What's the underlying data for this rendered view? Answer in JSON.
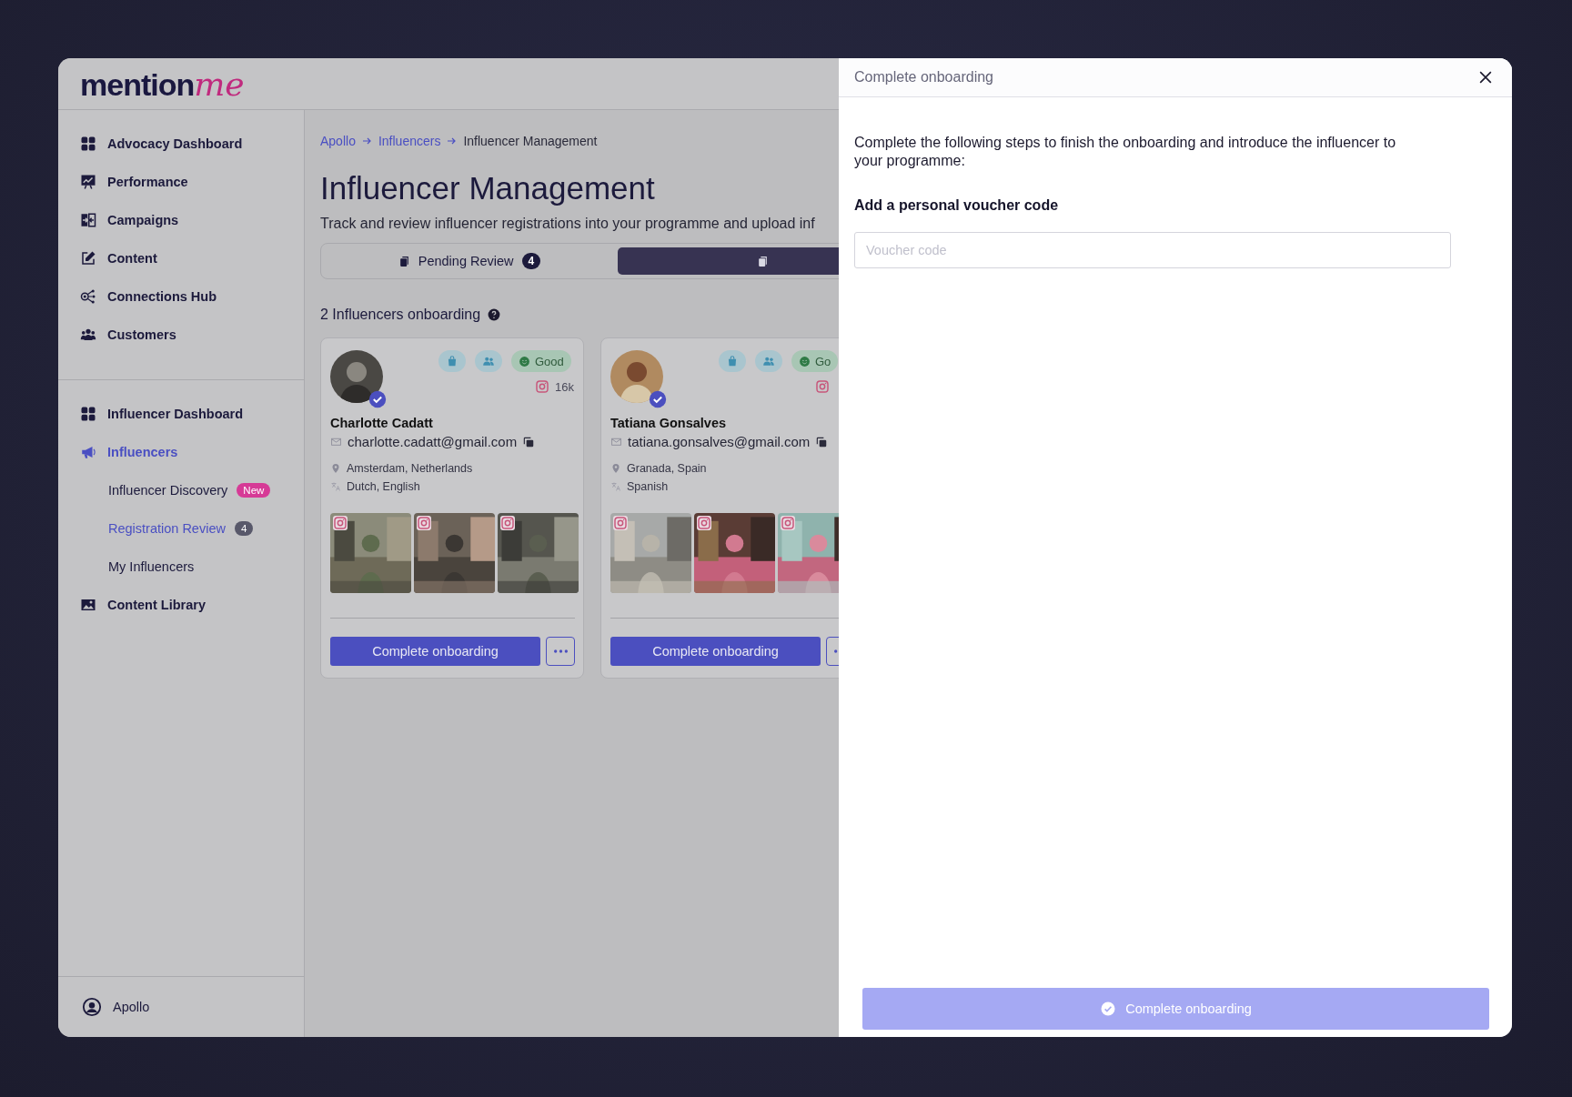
{
  "logo": {
    "word": "mention",
    "script": "me"
  },
  "sidebar": {
    "sections": [
      {
        "items": [
          {
            "label": "Advocacy Dashboard",
            "selected": false
          },
          {
            "label": "Performance",
            "selected": false
          },
          {
            "label": "Campaigns",
            "selected": false
          },
          {
            "label": "Content",
            "selected": false
          },
          {
            "label": "Connections Hub",
            "selected": false
          },
          {
            "label": "Customers",
            "selected": false
          }
        ]
      },
      {
        "items": [
          {
            "label": "Influencer Dashboard",
            "selected": false
          },
          {
            "label": "Influencers",
            "selected": true,
            "children": [
              {
                "label": "Influencer Discovery",
                "selected": false,
                "badge": {
                  "text": "New",
                  "color": "#d63a96"
                }
              },
              {
                "label": "Registration Review",
                "selected": true,
                "badge": {
                  "text": "4",
                  "color": "#58586a"
                }
              },
              {
                "label": "My Influencers",
                "selected": false
              }
            ]
          },
          {
            "label": "Content Library",
            "selected": false
          }
        ]
      }
    ],
    "user": {
      "name": "Apollo"
    }
  },
  "main": {
    "breadcrumb": [
      {
        "label": "Apollo",
        "link": true
      },
      {
        "label": "Influencers",
        "link": true
      },
      {
        "label": "Influencer Management",
        "link": false
      }
    ],
    "title": "Influencer Management",
    "description": "Track and review influencer registrations into your programme and upload inf",
    "tabs": [
      {
        "label": "Pending Review",
        "count": "4",
        "selected": false
      },
      {
        "selected": true
      }
    ],
    "section_title": "2 Influencers onboarding",
    "cards": [
      {
        "name": "Charlotte Cadatt",
        "email": "charlotte.cadatt@gmail.com",
        "location": "Amsterdam, Netherlands",
        "languages": "Dutch, English",
        "followers": "16k",
        "rating": "Good",
        "verified": true,
        "action": "Complete onboarding"
      },
      {
        "name": "Tatiana Gonsalves",
        "email": "tatiana.gonsalves@gmail.com",
        "location": "Granada, Spain",
        "languages": "Spanish",
        "rating": "Go",
        "verified": true,
        "action": "Complete onboarding"
      }
    ]
  },
  "drawer": {
    "title": "Complete onboarding",
    "intro": "Complete the following steps to finish the onboarding and introduce the influencer to your programme:",
    "step_title": "Add a personal voucher code",
    "voucher": {
      "placeholder": "Voucher code"
    },
    "submit": {
      "label": "Complete onboarding",
      "disabled": true
    }
  }
}
